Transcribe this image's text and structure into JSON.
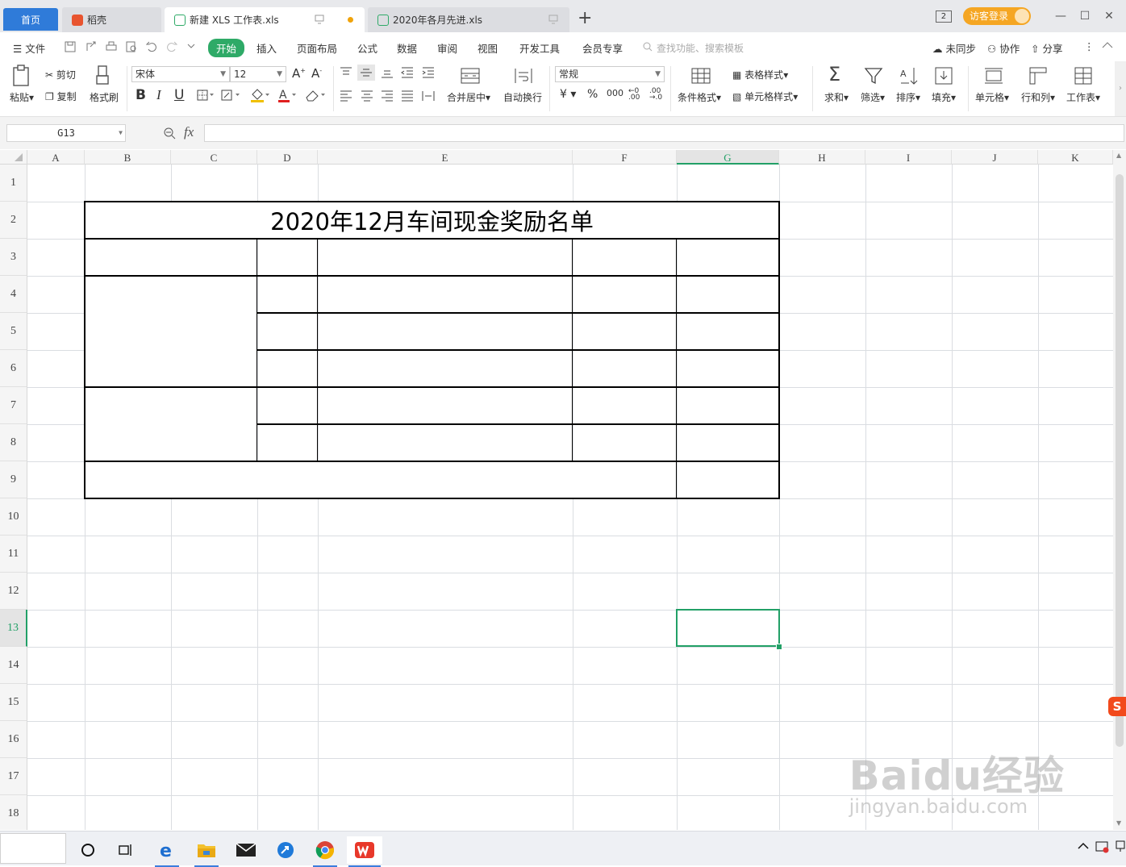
{
  "tabs": {
    "home": "首页",
    "daoke": "稻壳",
    "new_file": "新建 XLS 工作表.xls",
    "file_2020": "2020年各月先进.xls"
  },
  "window": {
    "login": "访客登录",
    "page_count": "2"
  },
  "menu": {
    "file": "文件",
    "items": [
      "开始",
      "插入",
      "页面布局",
      "公式",
      "数据",
      "审阅",
      "视图",
      "开发工具",
      "会员专享"
    ],
    "search_placeholder": "查找功能、搜索模板",
    "sync": "未同步",
    "collab": "协作",
    "share": "分享"
  },
  "ribbon": {
    "paste": "粘贴",
    "cut": "剪切",
    "copy": "复制",
    "format_painter": "格式刷",
    "font_name": "宋体",
    "font_size": "12",
    "merge_center": "合并居中",
    "wrap_text": "自动换行",
    "number_format": "常规",
    "conditional_format": "条件格式",
    "table_style": "表格样式",
    "cell_style": "单元格样式",
    "sum": "求和",
    "filter": "筛选",
    "sort": "排序",
    "fill": "填充",
    "cell": "单元格",
    "row_col": "行和列",
    "worksheet": "工作表"
  },
  "formula_bar": {
    "cell_ref": "G13",
    "fx": "fx",
    "content": ""
  },
  "sheet": {
    "columns": [
      "A",
      "B",
      "C",
      "D",
      "E",
      "F",
      "G",
      "H",
      "I",
      "J",
      "K"
    ],
    "rows": [
      "1",
      "2",
      "3",
      "4",
      "5",
      "6",
      "7",
      "8",
      "9",
      "10",
      "11",
      "12",
      "13",
      "14",
      "15",
      "16",
      "17",
      "18"
    ],
    "title": "2020年12月车间现金奖励名单",
    "selected_cell": "G13"
  },
  "watermark": {
    "brand": "Baidu经验",
    "url": "jingyan.baidu.com"
  },
  "colors": {
    "accent_green": "#2eaa67",
    "selection": "#22a067",
    "home_tab": "#2f7bd9",
    "login": "#f5a623"
  }
}
